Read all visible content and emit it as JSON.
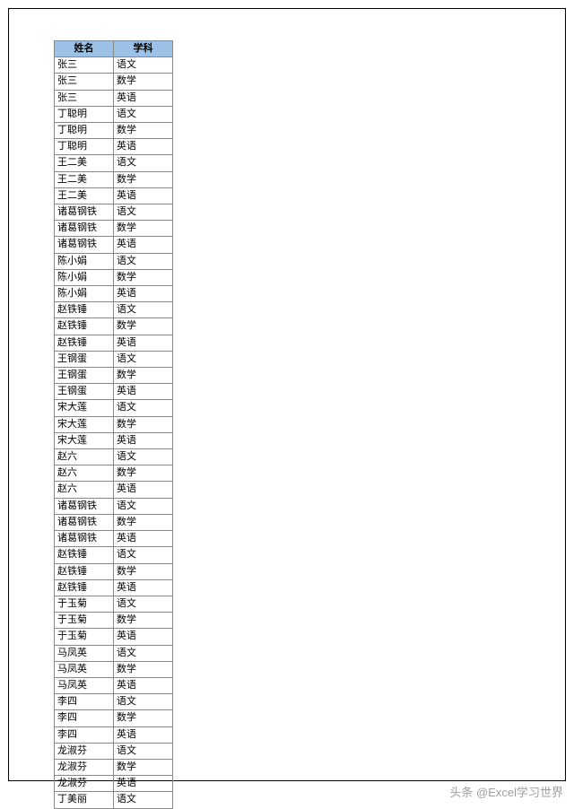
{
  "table": {
    "headers": {
      "name": "姓名",
      "subject": "学科"
    },
    "rows": [
      {
        "name": "张三",
        "subject": "语文"
      },
      {
        "name": "张三",
        "subject": "数学"
      },
      {
        "name": "张三",
        "subject": "英语"
      },
      {
        "name": "丁聪明",
        "subject": "语文"
      },
      {
        "name": "丁聪明",
        "subject": "数学"
      },
      {
        "name": "丁聪明",
        "subject": "英语"
      },
      {
        "name": "王二美",
        "subject": "语文"
      },
      {
        "name": "王二美",
        "subject": "数学"
      },
      {
        "name": "王二美",
        "subject": "英语"
      },
      {
        "name": "诸葛钢铁",
        "subject": "语文"
      },
      {
        "name": "诸葛钢铁",
        "subject": "数学"
      },
      {
        "name": "诸葛钢铁",
        "subject": "英语"
      },
      {
        "name": "陈小娟",
        "subject": "语文"
      },
      {
        "name": "陈小娟",
        "subject": "数学"
      },
      {
        "name": "陈小娟",
        "subject": "英语"
      },
      {
        "name": "赵铁锤",
        "subject": "语文"
      },
      {
        "name": "赵铁锤",
        "subject": "数学"
      },
      {
        "name": "赵铁锤",
        "subject": "英语"
      },
      {
        "name": "王钢蛋",
        "subject": "语文"
      },
      {
        "name": "王钢蛋",
        "subject": "数学"
      },
      {
        "name": "王钢蛋",
        "subject": "英语"
      },
      {
        "name": "宋大莲",
        "subject": "语文"
      },
      {
        "name": "宋大莲",
        "subject": "数学"
      },
      {
        "name": "宋大莲",
        "subject": "英语"
      },
      {
        "name": "赵六",
        "subject": "语文"
      },
      {
        "name": "赵六",
        "subject": "数学"
      },
      {
        "name": "赵六",
        "subject": "英语"
      },
      {
        "name": "诸葛钢铁",
        "subject": "语文"
      },
      {
        "name": "诸葛钢铁",
        "subject": "数学"
      },
      {
        "name": "诸葛钢铁",
        "subject": "英语"
      },
      {
        "name": "赵铁锤",
        "subject": "语文"
      },
      {
        "name": "赵铁锤",
        "subject": "数学"
      },
      {
        "name": "赵铁锤",
        "subject": "英语"
      },
      {
        "name": "于玉菊",
        "subject": "语文"
      },
      {
        "name": "于玉菊",
        "subject": "数学"
      },
      {
        "name": "于玉菊",
        "subject": "英语"
      },
      {
        "name": "马凤英",
        "subject": "语文"
      },
      {
        "name": "马凤英",
        "subject": "数学"
      },
      {
        "name": "马凤英",
        "subject": "英语"
      },
      {
        "name": "李四",
        "subject": "语文"
      },
      {
        "name": "李四",
        "subject": "数学"
      },
      {
        "name": "李四",
        "subject": "英语"
      },
      {
        "name": "龙淑芬",
        "subject": "语文"
      },
      {
        "name": "龙淑芬",
        "subject": "数学"
      },
      {
        "name": "龙淑芬",
        "subject": "英语"
      },
      {
        "name": "丁美丽",
        "subject": "语文"
      }
    ]
  },
  "attribution": "头条 @Excel学习世界"
}
